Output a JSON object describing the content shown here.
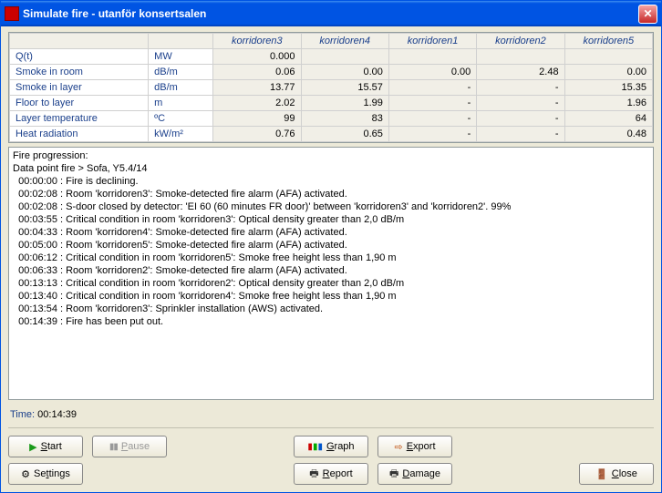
{
  "window": {
    "title": "Simulate fire - utanför konsertsalen"
  },
  "table": {
    "headers": [
      "korridoren3",
      "korridoren4",
      "korridoren1",
      "korridoren2",
      "korridoren5"
    ],
    "rows": [
      {
        "label": "Q(t)",
        "unit": "MW",
        "vals": [
          "0.000",
          "",
          "",
          "",
          ""
        ]
      },
      {
        "label": "Smoke in room",
        "unit": "dB/m",
        "vals": [
          "0.06",
          "0.00",
          "0.00",
          "2.48",
          "0.00"
        ]
      },
      {
        "label": "Smoke in layer",
        "unit": "dB/m",
        "vals": [
          "13.77",
          "15.57",
          "-",
          "-",
          "15.35"
        ]
      },
      {
        "label": "Floor to layer",
        "unit": "m",
        "vals": [
          "2.02",
          "1.99",
          "-",
          "-",
          "1.96"
        ]
      },
      {
        "label": "Layer temperature",
        "unit": "ºC",
        "vals": [
          "99",
          "83",
          "-",
          "-",
          "64"
        ]
      },
      {
        "label": "Heat radiation",
        "unit": "kW/m²",
        "vals": [
          "0.76",
          "0.65",
          "-",
          "-",
          "0.48"
        ]
      }
    ]
  },
  "log": [
    "Fire progression:",
    "Data point fire > Sofa, Y5.4/14",
    "  00:00:00 : Fire is declining.",
    "  00:02:08 : Room 'korridoren3': Smoke-detected fire alarm (AFA) activated.",
    "  00:02:08 : S-door closed by detector: 'EI 60 (60 minutes FR door)' between 'korridoren3' and 'korridoren2'. 99%",
    "  00:03:55 : Critical condition in room 'korridoren3': Optical density greater than 2,0 dB/m",
    "  00:04:33 : Room 'korridoren4': Smoke-detected fire alarm (AFA) activated.",
    "  00:05:00 : Room 'korridoren5': Smoke-detected fire alarm (AFA) activated.",
    "  00:06:12 : Critical condition in room 'korridoren5': Smoke free height less than 1,90 m",
    "  00:06:33 : Room 'korridoren2': Smoke-detected fire alarm (AFA) activated.",
    "  00:13:13 : Critical condition in room 'korridoren2': Optical density greater than 2,0 dB/m",
    "  00:13:40 : Critical condition in room 'korridoren4': Smoke free height less than 1,90 m",
    "  00:13:54 : Room 'korridoren3': Sprinkler installation (AWS) activated.",
    "  00:14:39 : Fire has been put out."
  ],
  "time": {
    "label": "Time: ",
    "value": "00:14:39"
  },
  "buttons": {
    "start": "Start",
    "pause": "Pause",
    "settings": "Settings",
    "graph": "Graph",
    "export": "Export",
    "report": "Report",
    "damage": "Damage",
    "close": "Close"
  }
}
